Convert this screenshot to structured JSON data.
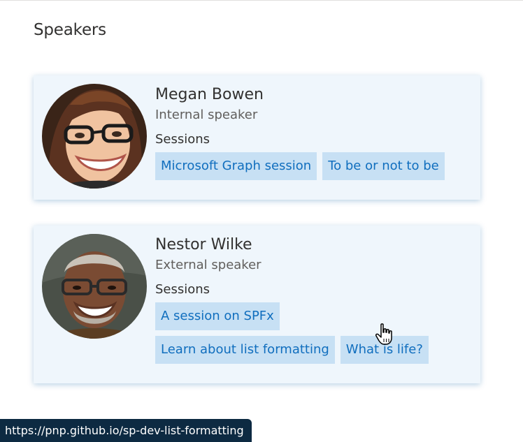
{
  "page": {
    "title": "Speakers",
    "status_url": "https://pnp.github.io/sp-dev-list-formatting"
  },
  "speakers": [
    {
      "name": "Megan Bowen",
      "role": "Internal speaker",
      "sessions_label": "Sessions",
      "sessions": [
        "Microsoft Graph session",
        "To be or not to be"
      ]
    },
    {
      "name": "Nestor Wilke",
      "role": "External speaker",
      "sessions_label": "Sessions",
      "sessions": [
        "A session on SPFx",
        "Learn about list formatting",
        "What is life?"
      ]
    }
  ],
  "colors": {
    "card_background": "#eff6fc",
    "chip_background": "#c7e0f4",
    "chip_text": "#106ebe",
    "status_bar": "#0d2a42"
  },
  "icons": {
    "cursor": "hand-pointer-icon"
  }
}
